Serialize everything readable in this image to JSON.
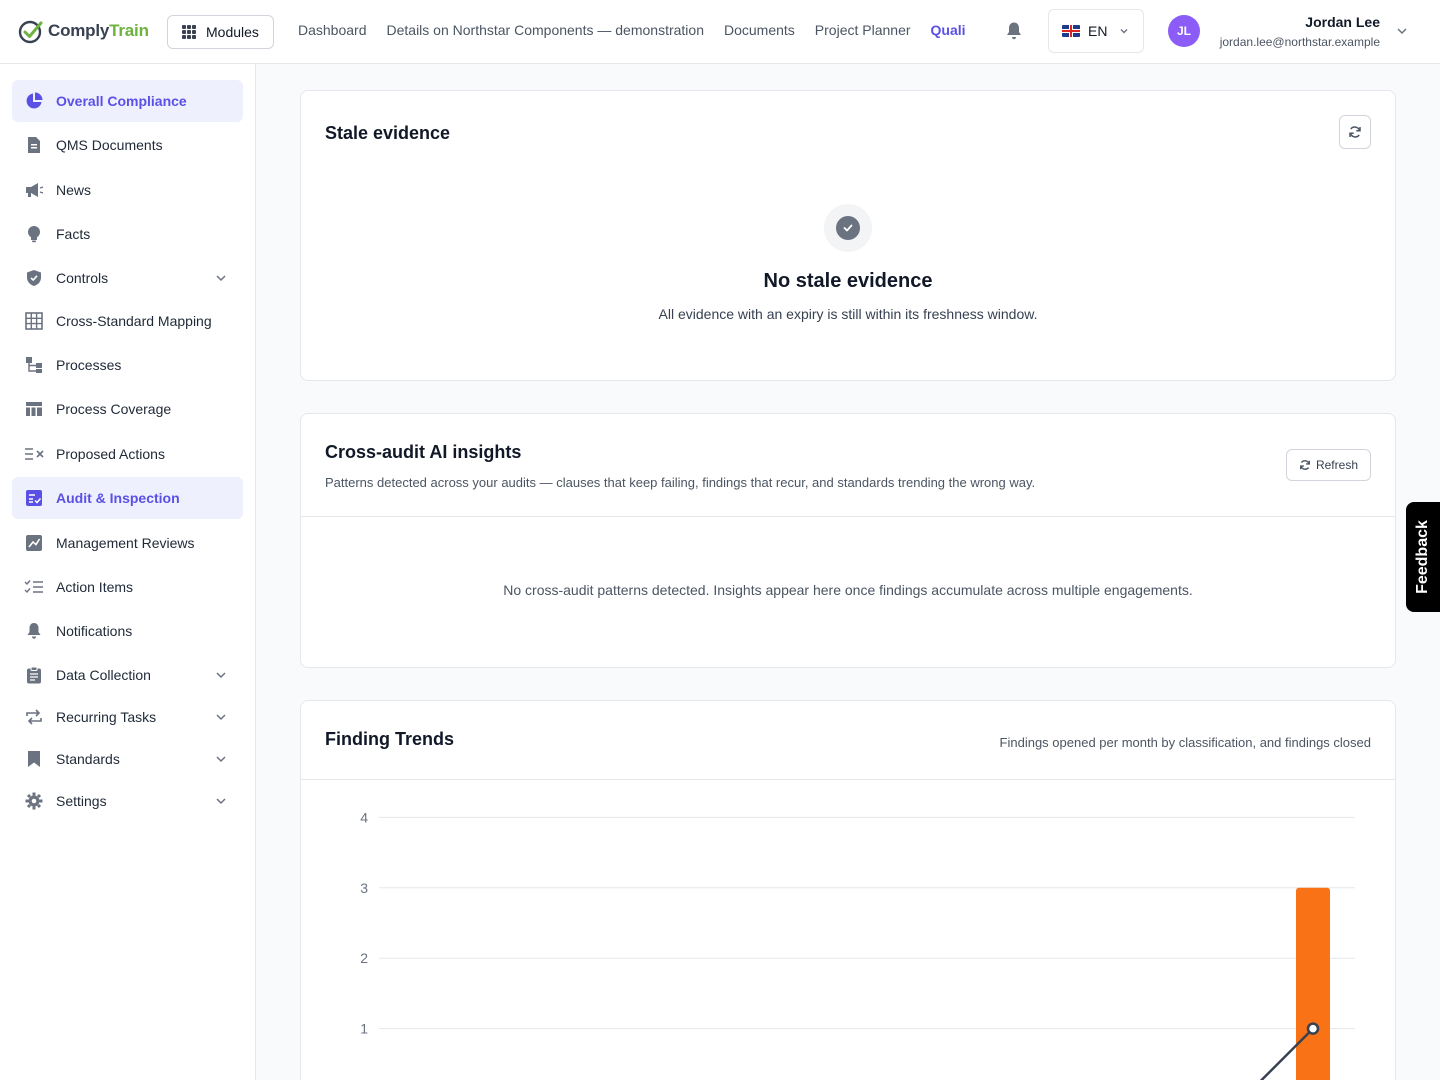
{
  "brand": {
    "name_main": "Comply",
    "name_accent": "Train"
  },
  "header": {
    "modules_label": "Modules",
    "nav": [
      {
        "label": "Dashboard",
        "active": false
      },
      {
        "label": "Details on Northstar Components — demonstration",
        "active": false
      },
      {
        "label": "Documents",
        "active": false
      },
      {
        "label": "Project Planner",
        "active": false
      },
      {
        "label": "Quali",
        "active": true
      }
    ],
    "language": "EN",
    "user": {
      "initials": "JL",
      "name": "Jordan Lee",
      "email": "jordan.lee@northstar.example"
    }
  },
  "sidebar": {
    "items": [
      {
        "label": "Overall Compliance",
        "icon": "pie-chart-icon",
        "active": true,
        "expandable": false
      },
      {
        "label": "QMS Documents",
        "icon": "document-icon",
        "active": false,
        "expandable": false
      },
      {
        "label": "News",
        "icon": "megaphone-icon",
        "active": false,
        "expandable": false
      },
      {
        "label": "Facts",
        "icon": "lightbulb-icon",
        "active": false,
        "expandable": false
      },
      {
        "label": "Controls",
        "icon": "shield-icon",
        "active": false,
        "expandable": true
      },
      {
        "label": "Cross-Standard Mapping",
        "icon": "table-grid-icon",
        "active": false,
        "expandable": false
      },
      {
        "label": "Processes",
        "icon": "flow-icon",
        "active": false,
        "expandable": false
      },
      {
        "label": "Process Coverage",
        "icon": "layout-icon",
        "active": false,
        "expandable": false
      },
      {
        "label": "Proposed Actions",
        "icon": "list-x-icon",
        "active": false,
        "expandable": false
      },
      {
        "label": "Audit & Inspection",
        "icon": "clipboard-check-icon",
        "active": true,
        "expandable": false
      },
      {
        "label": "Management Reviews",
        "icon": "chart-edit-icon",
        "active": false,
        "expandable": false
      },
      {
        "label": "Action Items",
        "icon": "checklist-icon",
        "active": false,
        "expandable": false
      },
      {
        "label": "Notifications",
        "icon": "bell-icon",
        "active": false,
        "expandable": false
      },
      {
        "label": "Data Collection",
        "icon": "clipboard-icon",
        "active": false,
        "expandable": true
      },
      {
        "label": "Recurring Tasks",
        "icon": "repeat-icon",
        "active": false,
        "expandable": true
      },
      {
        "label": "Standards",
        "icon": "bookmark-icon",
        "active": false,
        "expandable": true
      },
      {
        "label": "Settings",
        "icon": "gear-icon",
        "active": false,
        "expandable": true
      }
    ]
  },
  "stale_evidence": {
    "title": "Stale evidence",
    "empty_title": "No stale evidence",
    "empty_desc": "All evidence with an expiry is still within its freshness window."
  },
  "cross_audit": {
    "title": "Cross-audit AI insights",
    "subtitle": "Patterns detected across your audits — clauses that keep failing, findings that recur, and standards trending the wrong way.",
    "refresh_label": "Refresh",
    "empty": "No cross-audit patterns detected. Insights appear here once findings accumulate across multiple engagements."
  },
  "finding_trends": {
    "title": "Finding Trends",
    "subtitle": "Findings opened per month by classification, and findings closed"
  },
  "feedback_label": "Feedback",
  "colors": {
    "accent": "#5b50e6",
    "bar": "#f97316",
    "line": "#374151"
  },
  "chart_data": {
    "type": "bar",
    "title": "Finding Trends",
    "ylim": [
      0,
      4
    ],
    "yticks": [
      1,
      2,
      3,
      4
    ],
    "grid": true,
    "series": [
      {
        "kind": "bar",
        "values": [
          3
        ]
      },
      {
        "kind": "line",
        "values": [
          1
        ]
      }
    ]
  }
}
